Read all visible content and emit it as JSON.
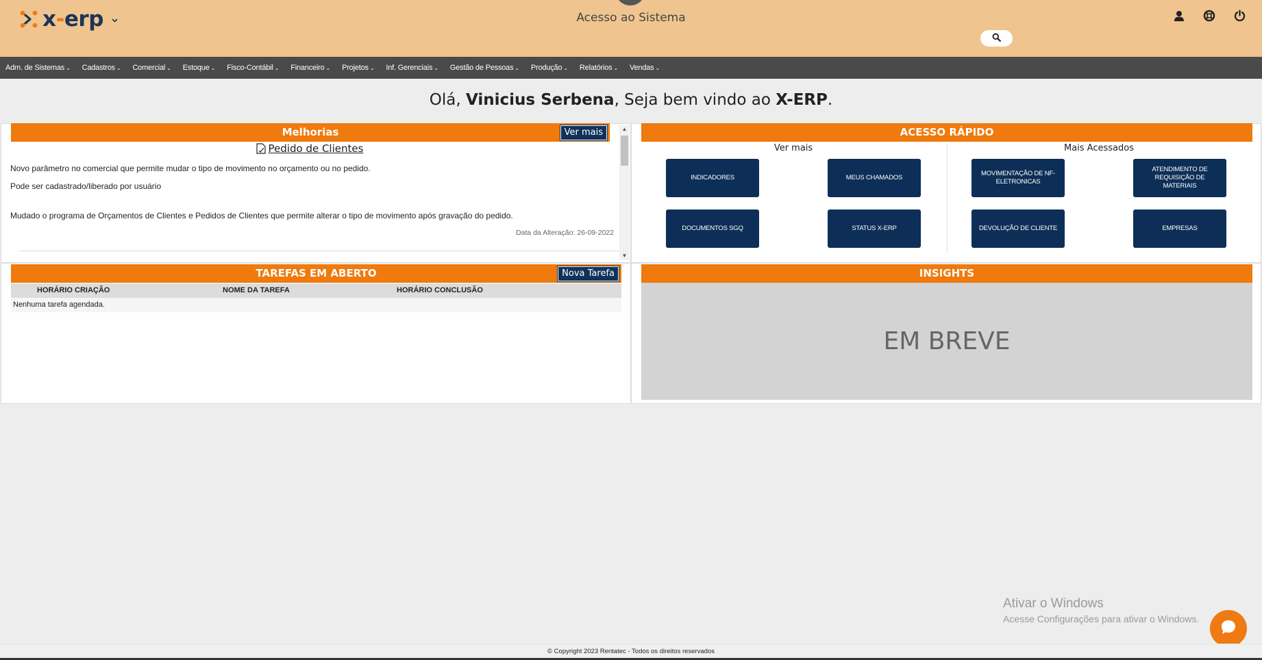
{
  "app": {
    "logo_text_left": "x",
    "logo_text_dash": "-",
    "logo_text_right": "erp",
    "title": "Acesso ao Sistema"
  },
  "icons": {
    "logo": "x-erp-logo-icon",
    "caret": "chevron-down-icon",
    "search": "search-icon",
    "user": "user-icon",
    "help": "lifebuoy-icon",
    "power": "power-icon",
    "chat": "chat-bubble-icon",
    "doc": "document-edit-icon"
  },
  "colors": {
    "header_bg": "#efc48f",
    "menubar_bg": "#4a4a4a",
    "accent_orange": "#ef7a0d",
    "navy": "#0d2f57"
  },
  "menu": [
    {
      "label": "Adm. de Sistemas"
    },
    {
      "label": "Cadastros"
    },
    {
      "label": "Comercial"
    },
    {
      "label": "Estoque"
    },
    {
      "label": "Fisco-Contábil"
    },
    {
      "label": "Financeiro"
    },
    {
      "label": "Projetos"
    },
    {
      "label": "Inf. Gerenciais"
    },
    {
      "label": "Gestão de Pessoas"
    },
    {
      "label": "Produção"
    },
    {
      "label": "Relatórios"
    },
    {
      "label": "Vendas"
    }
  ],
  "welcome": {
    "greeting": "Olá, ",
    "user_name": "Vinicius Serbena",
    "middle": ", Seja bem vindo ao ",
    "system": "X-ERP",
    "end": "."
  },
  "melhorias": {
    "title": "Melhorias",
    "more_label": "Ver mais",
    "item_title": "Pedido de Clientes",
    "lines": [
      "Novo parâmetro no comercial que permite mudar o tipo de movimento no orçamento ou no pedido.",
      "Pode ser cadastrado/liberado por usuário",
      "Mudado o programa de Orçamentos de Clientes e Pedidos de Clientes que permite alterar o tipo de movimento após gravação do pedido."
    ],
    "date": "Data da Alteração: 26-09-2022"
  },
  "acesso_rapido": {
    "title": "ACESSO RÁPIDO",
    "col_left_title": "Ver mais",
    "col_right_title": "Mais Acessados",
    "buttons": [
      "INDICADORES",
      "MEUS CHAMADOS",
      "MOVIMENTAÇÃO DE NF-ELETRONICAS",
      "ATENDIMENTO DE REQUISIÇÃO DE MATERIAIS",
      "DOCUMENTOS SGQ",
      "STATUS X-ERP",
      "DEVOLUÇÃO DE CLIENTE",
      "EMPRESAS"
    ]
  },
  "tarefas": {
    "title": "TAREFAS EM ABERTO",
    "new_label": "Nova Tarefa",
    "columns": [
      "HORÁRIO CRIAÇÃO",
      "NOME DA TAREFA",
      "HORÁRIO CONCLUSÃO"
    ],
    "empty": "Nenhuma tarefa agendada."
  },
  "insights": {
    "title": "INSIGHTS",
    "body": "EM BREVE"
  },
  "watermark": {
    "line1": "Ativar o Windows",
    "line2": "Acesse Configurações para ativar o Windows."
  },
  "footer": {
    "copyright": "© Copyright 2023 Rentatec - Todos os direitos reservados"
  }
}
